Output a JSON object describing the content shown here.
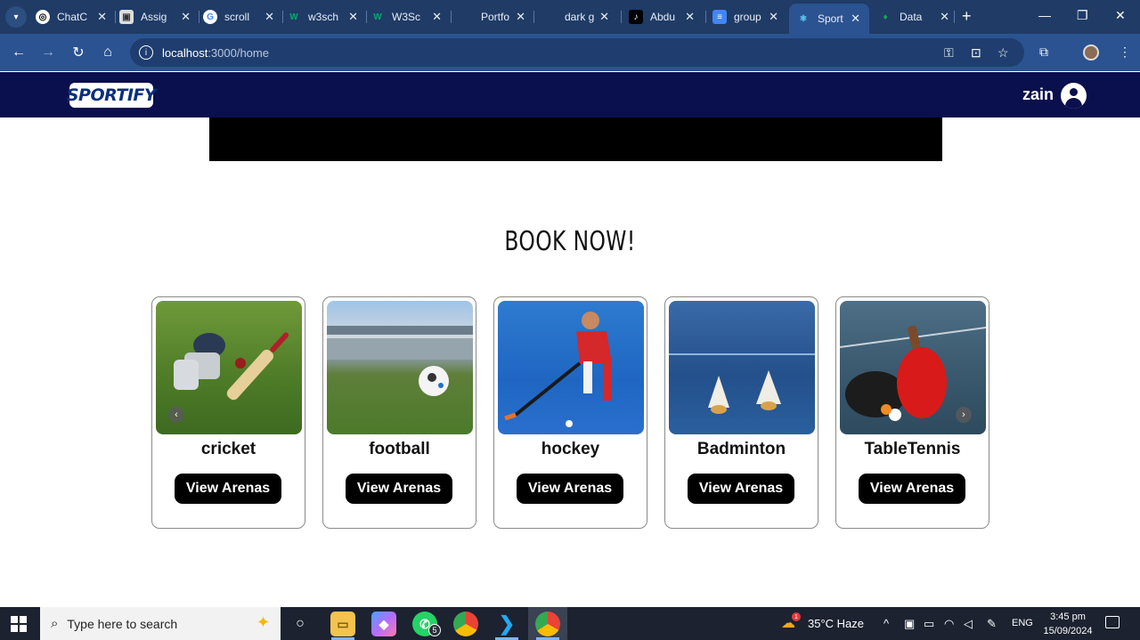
{
  "browser": {
    "tabs": [
      {
        "label": "ChatC",
        "favicon": "chatgpt-icon",
        "active": false
      },
      {
        "label": "Assig",
        "favicon": "classroom-icon",
        "active": false
      },
      {
        "label": "scroll",
        "favicon": "google-icon",
        "active": false
      },
      {
        "label": "w3sch",
        "favicon": "w3schools-icon",
        "active": false
      },
      {
        "label": "W3Sc",
        "favicon": "w3schools-icon",
        "active": false
      },
      {
        "label": "Portfo",
        "favicon": "",
        "active": false
      },
      {
        "label": "dark g",
        "favicon": "",
        "active": false
      },
      {
        "label": "Abdu",
        "favicon": "tiktok-icon",
        "active": false
      },
      {
        "label": "group",
        "favicon": "docs-icon",
        "active": false
      },
      {
        "label": "Sport",
        "favicon": "react-icon",
        "active": true
      },
      {
        "label": "Data",
        "favicon": "mongodb-icon",
        "active": false
      }
    ],
    "url_host": "localhost",
    "url_path": ":3000/home"
  },
  "header": {
    "logo": "SPORTIFY",
    "username": "zain"
  },
  "main": {
    "title": "BOOK  NOW!",
    "cards": [
      {
        "name": "cricket",
        "button": "View Arenas"
      },
      {
        "name": "football",
        "button": "View Arenas"
      },
      {
        "name": "hockey",
        "button": "View Arenas"
      },
      {
        "name": "Badminton",
        "button": "View Arenas"
      },
      {
        "name": "TableTennis",
        "button": "View Arenas"
      }
    ],
    "prev_arrow": "‹",
    "next_arrow": "›"
  },
  "taskbar": {
    "search_placeholder": "Type here to search",
    "whatsapp_badge": "5",
    "weather": "35°C  Haze",
    "weather_badge": "1",
    "language": "ENG",
    "time": "3:45 pm",
    "date": "15/09/2024"
  },
  "colors": {
    "tabstrip": "#1f3b66",
    "toolbar": "#2b5391",
    "app_header": "#0a0f4d",
    "button": "#000000"
  }
}
